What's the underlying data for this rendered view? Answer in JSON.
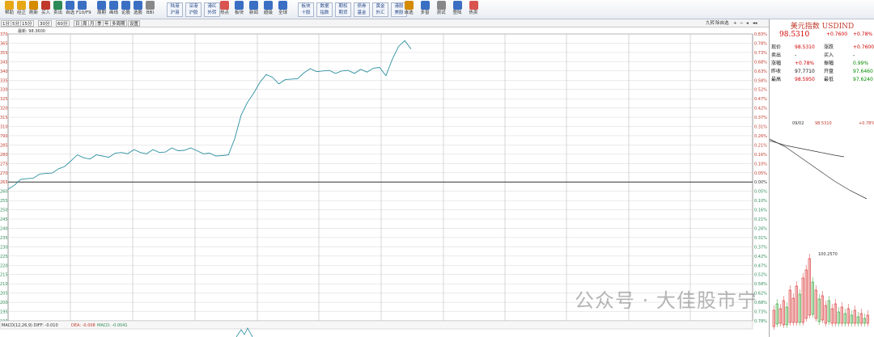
{
  "toolbar": {
    "buttons": [
      {
        "label": "帮助",
        "icon": "lightbulb-icon",
        "color": "#e6a817"
      },
      {
        "label": "经正",
        "icon": "smile-icon",
        "color": "#e6a817"
      },
      {
        "label": "刷新",
        "icon": "refresh-icon",
        "color": "#d48b00"
      },
      {
        "label": "买入",
        "icon": "buy-icon",
        "color": "#c0392b"
      },
      {
        "label": "卖出",
        "icon": "sell-icon",
        "color": "#2e8b57"
      },
      {
        "label": "自选",
        "icon": "star-icon",
        "color": "#3a6fc4"
      },
      {
        "label": "F10/F9",
        "icon": "f10-icon",
        "color": "#3a6fc4"
      },
      {
        "label": "周期",
        "icon": "cycle-icon",
        "color": "#3a6fc4"
      },
      {
        "label": "画线",
        "icon": "pencil-icon",
        "color": "#3a6fc4"
      },
      {
        "label": "论股",
        "icon": "comment-icon",
        "color": "#3a6fc4"
      },
      {
        "label": "选股",
        "icon": "filter-icon",
        "color": "#3a6fc4"
      },
      {
        "label": "BBI",
        "icon": "bbi-icon",
        "color": "#888888"
      }
    ],
    "group1": [
      [
        "陆港",
        "沪港"
      ],
      [
        "深港",
        "沪股"
      ],
      [
        "港红",
        "外转"
      ]
    ],
    "group2": [
      "热点",
      "板块",
      "新闻",
      "超级",
      "全球"
    ],
    "group3": [
      [
        "板块",
        "十股"
      ],
      [
        "数据",
        "指数"
      ],
      [
        "期权",
        "期货"
      ],
      [
        "债券",
        "基金"
      ],
      [
        "黄金",
        "外汇"
      ],
      [
        "港股",
        "美股"
      ]
    ],
    "right_buttons": [
      "自选",
      "多窗",
      "测试",
      "登陆",
      "热卖"
    ]
  },
  "timeframe": {
    "items": [
      "1分",
      "5分",
      "15分",
      "30分",
      "60分",
      "日",
      "周",
      "月",
      "季",
      "年",
      "多周期",
      "设置"
    ],
    "right_label": "九转",
    "right_label2": "除自选"
  },
  "quote": {
    "title": "美元指数 USDIND",
    "price": "98.5310",
    "change": "+0.7600",
    "change_pct": "+0.78%",
    "rows": [
      {
        "l1": "现价",
        "v1": "98.5310",
        "l2": "涨跌",
        "v2": "+0.7600"
      },
      {
        "l1": "卖出",
        "v1": "-",
        "l2": "买入",
        "v2": "-"
      },
      {
        "l1": "涨幅",
        "v1": "+0.78%",
        "l2": "振幅",
        "v2": "0.99%"
      },
      {
        "l1": "昨收",
        "v1": "97.7710",
        "l2": "开盘",
        "v2": "97.6460"
      },
      {
        "l1": "最高",
        "v1": "98.5950",
        "l2": "最低",
        "v2": "97.6240"
      }
    ],
    "mini_date": "09/02",
    "mini_price": "98.5310",
    "mini_pct": "+0.78%",
    "kline_label": "100.2570"
  },
  "chart_data": {
    "type": "line",
    "title": "",
    "price_readout": "最新: 98.3600",
    "baseline": 97.771,
    "y_left_labels": [
      "370",
      "365",
      "355",
      "345",
      "340",
      "335",
      "330",
      "325",
      "320",
      "315",
      "310",
      "790",
      "285",
      "280",
      "275",
      "270",
      "265",
      "260",
      "255",
      "250",
      "245",
      "240",
      "235",
      "230",
      "225",
      "220",
      "215",
      "210",
      "205",
      "200",
      "195",
      "190",
      "185",
      "180",
      "175",
      "170",
      "165",
      "160",
      "155",
      "150",
      "145",
      "140",
      "135",
      "130",
      "125",
      "120"
    ],
    "y_right_labels": [
      "0.83%",
      "0.78%",
      "0.73%",
      "0.68%",
      "0.63%",
      "0.58%",
      "0.52%",
      "0.47%",
      "0.42%",
      "0.37%",
      "0.31%",
      "0.26%",
      "0.21%",
      "0.16%",
      "0.10%",
      "0.05%",
      "0.00%",
      "0.05%",
      "0.10%",
      "0.16%",
      "0.21%",
      "0.26%",
      "0.31%",
      "0.37%",
      "0.42%",
      "0.47%",
      "0.52%",
      "0.58%",
      "0.62%",
      "0.68%",
      "0.73%",
      "0.78%"
    ],
    "series": [
      {
        "values": [
          97.73,
          97.76,
          97.78,
          97.79,
          97.8,
          97.81,
          97.82,
          97.83,
          97.84,
          97.86,
          97.9,
          97.92,
          97.91,
          97.91,
          97.92,
          97.92,
          97.92,
          97.93,
          97.94,
          97.94,
          97.95,
          97.94,
          97.94,
          97.95,
          97.94,
          97.95,
          97.96,
          97.95,
          97.96,
          97.96,
          97.95,
          97.94,
          97.93,
          97.92,
          97.93,
          97.92,
          98.02,
          98.16,
          98.22,
          98.28,
          98.35,
          98.38,
          98.37,
          98.34,
          98.35,
          98.36,
          98.37,
          98.39,
          98.42,
          98.41,
          98.4,
          98.41,
          98.4,
          98.4,
          98.41,
          98.4,
          98.41,
          98.4,
          98.43,
          98.42,
          98.38,
          98.48,
          98.54,
          98.58,
          98.54
        ]
      }
    ],
    "macd": {
      "label": "MACD(12,26,9) DIFF: -0.010",
      "dea": "DEA: -0.008",
      "macd": "MACD: -0.0041"
    }
  },
  "watermark": "公众号 · 大佳股市宁"
}
